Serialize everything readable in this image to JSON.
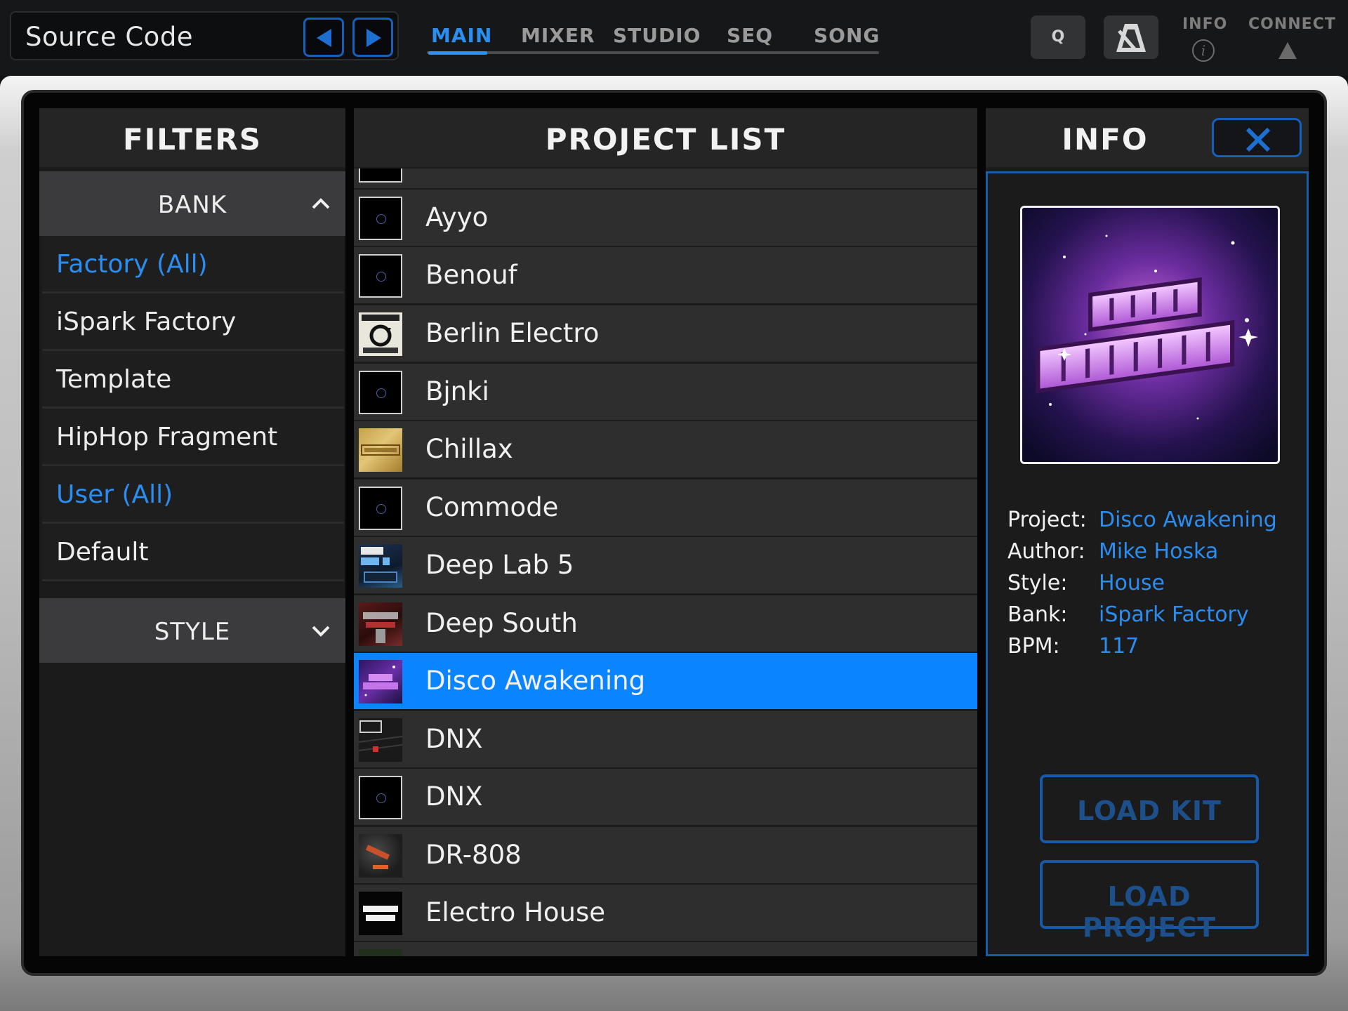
{
  "header": {
    "title": "Source Code",
    "tabs": [
      {
        "label": "MAIN",
        "active": true
      },
      {
        "label": "MIXER",
        "active": false
      },
      {
        "label": "STUDIO",
        "active": false
      },
      {
        "label": "SEQ",
        "active": false
      },
      {
        "label": "SONG",
        "active": false
      }
    ],
    "q_label": "Q",
    "info_label": "INFO",
    "info_icon": "i",
    "connect_label": "CONNECT",
    "accent_color": "#2a8ff0"
  },
  "filters": {
    "title": "FILTERS",
    "bank_label": "BANK",
    "style_label": "STYLE",
    "items": [
      {
        "label": "Factory (All)",
        "highlight": true
      },
      {
        "label": "iSpark Factory",
        "highlight": false
      },
      {
        "label": "Template",
        "highlight": false
      },
      {
        "label": "HipHop Fragment",
        "highlight": false
      },
      {
        "label": "User (All)",
        "highlight": true
      },
      {
        "label": "Default",
        "highlight": false
      }
    ]
  },
  "projects": {
    "title": "PROJECT LIST",
    "items": [
      {
        "name": "Ayyo",
        "thumb": "default"
      },
      {
        "name": "Benouf",
        "thumb": "default"
      },
      {
        "name": "Berlin Electro",
        "thumb": "berlin"
      },
      {
        "name": "Bjnki",
        "thumb": "default"
      },
      {
        "name": "Chillax",
        "thumb": "chillax"
      },
      {
        "name": "Commode",
        "thumb": "default"
      },
      {
        "name": "Deep Lab 5",
        "thumb": "deeplab"
      },
      {
        "name": "Deep South",
        "thumb": "deepsouth"
      },
      {
        "name": "Disco Awakening",
        "thumb": "disco",
        "selected": true
      },
      {
        "name": "DNX",
        "thumb": "dnx"
      },
      {
        "name": "DNX",
        "thumb": "default"
      },
      {
        "name": "DR-808",
        "thumb": "dr808"
      },
      {
        "name": "Electro House",
        "thumb": "electro"
      }
    ]
  },
  "info": {
    "title": "INFO",
    "project_label": "Project:",
    "project": "Disco Awakening",
    "author_label": "Author:",
    "author": "Mike Hoska",
    "style_label": "Style:",
    "style": "House",
    "bank_label": "Bank:",
    "bank": "iSpark Factory",
    "bpm_label": "BPM:",
    "bpm": "117",
    "load_kit": "LOAD KIT",
    "load_project": "LOAD PROJECT"
  }
}
